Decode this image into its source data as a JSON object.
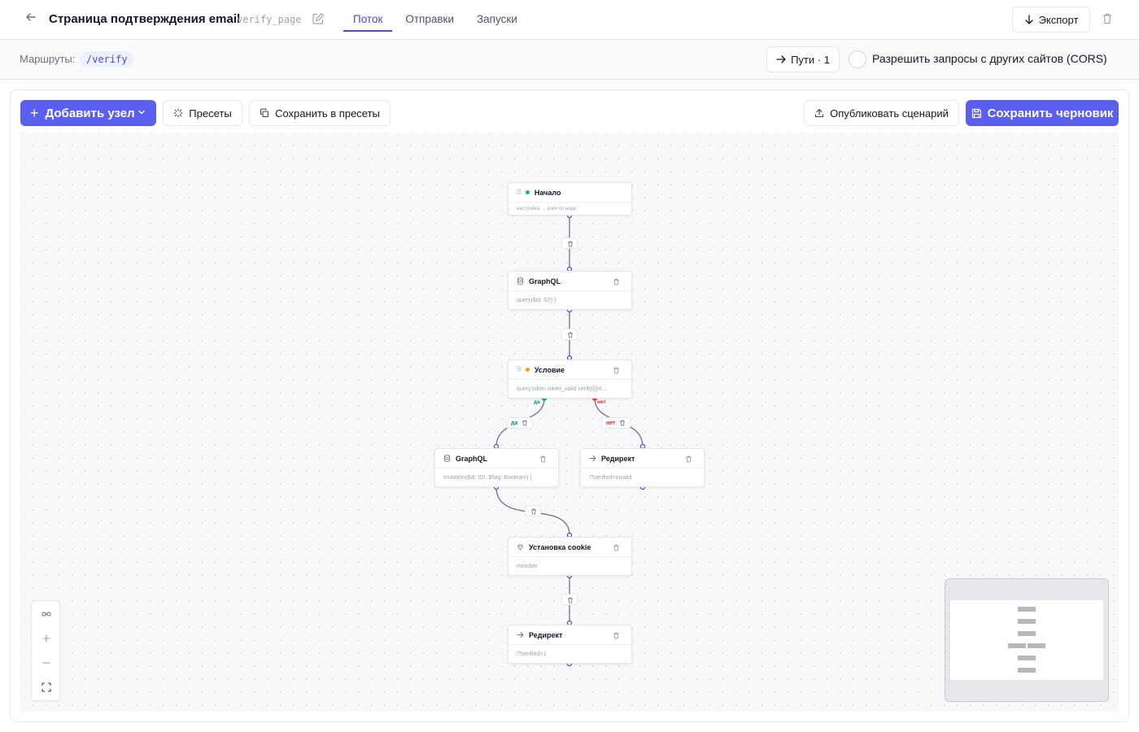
{
  "header": {
    "title": "Страница подтверждения email",
    "slug": "verify_page",
    "tabs": [
      {
        "label": "Поток",
        "active": true
      },
      {
        "label": "Отправки",
        "active": false
      },
      {
        "label": "Запуски",
        "active": false
      }
    ],
    "export_label": "Экспорт"
  },
  "routes": {
    "label": "Маршруты:",
    "items": [
      "/verify"
    ],
    "paths_label": "Пути · 1",
    "cors_label": "Разрешить запросы с других сайтов (CORS)",
    "cors_enabled": false
  },
  "toolbar": {
    "add_node_label": "Добавить узел",
    "presets_label": "Пресеты",
    "save_presets_label": "Сохранить в пресеты",
    "publish_label": "Опубликовать сценарий",
    "save_draft_label": "Сохранить черновик"
  },
  "colors": {
    "accent": "#5b5ff0",
    "edge": "#6b7280",
    "handle": "#4f46e5",
    "start_dot": "#10b981",
    "condition_dot": "#f59e0b",
    "yes": "#059669",
    "no": "#dc2626"
  },
  "nodes": {
    "start": {
      "title": "Начало",
      "body": "настройка → клик по ноде",
      "icon": "grip-icon"
    },
    "graphql1": {
      "title": "GraphQL",
      "body": "query($id: ID!) {",
      "icon": "database-icon"
    },
    "condition": {
      "title": "Условие",
      "body": "query.token token_valid verify[{{re...",
      "icon": "grip-icon"
    },
    "graphql2": {
      "title": "GraphQL",
      "body": "mutation($id: ID!, $flag: Boolean!) {",
      "icon": "database-icon"
    },
    "redirect_invalid": {
      "title": "Редирект",
      "body": "/?verified=invalid",
      "icon": "arrow-right-icon"
    },
    "cookie": {
      "title": "Установка cookie",
      "body": "member",
      "icon": "plug-icon"
    },
    "redirect_ok": {
      "title": "Редирект",
      "body": "/?verified=1",
      "icon": "arrow-right-icon"
    }
  },
  "edges": {
    "yes_label": "да",
    "no_label": "нет"
  }
}
